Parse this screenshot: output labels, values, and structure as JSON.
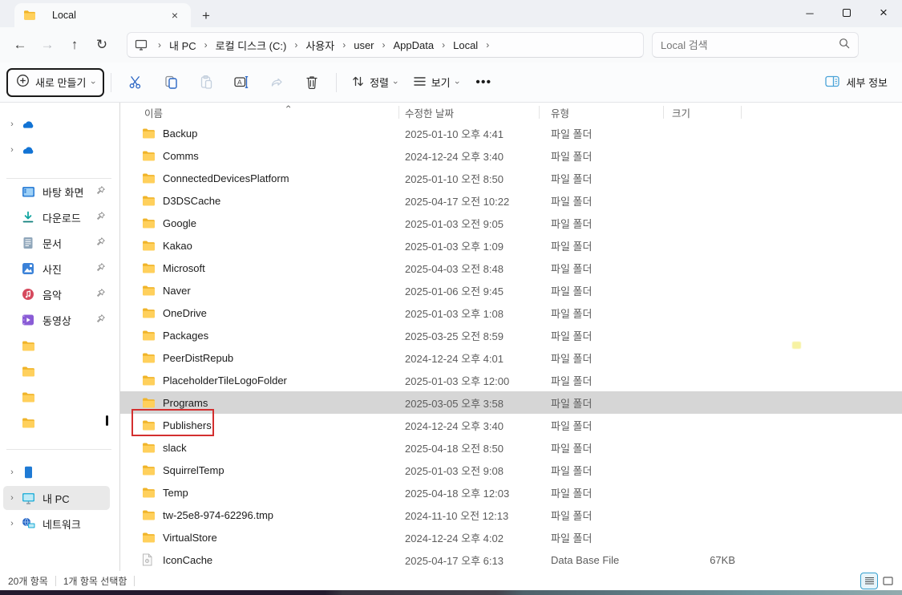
{
  "tabbar": {
    "tab_label": "Local",
    "close_glyph": "×",
    "newtab_glyph": "+",
    "minimize_glyph": "─",
    "close_window_glyph": "×"
  },
  "navbar": {
    "back_glyph": "←",
    "forward_glyph": "→",
    "up_glyph": "↑",
    "refresh_glyph": "↻",
    "breadcrumbs": [
      "내 PC",
      "로컬 디스크 (C:)",
      "사용자",
      "user",
      "AppData",
      "Local"
    ],
    "crumb_sep": "›",
    "search_placeholder": "Local 검색"
  },
  "toolbar": {
    "new_label": "새로 만들기",
    "sort_label": "정렬",
    "view_label": "보기",
    "more_label": "•••",
    "details_label": "세부 정보"
  },
  "sidebar": {
    "pinned": [
      {
        "label": "바탕 화면",
        "icon": "desktop-icon"
      },
      {
        "label": "다운로드",
        "icon": "downloads-icon"
      },
      {
        "label": "문서",
        "icon": "documents-icon"
      },
      {
        "label": "사진",
        "icon": "pictures-icon"
      },
      {
        "label": "음악",
        "icon": "music-icon"
      },
      {
        "label": "동영상",
        "icon": "videos-icon"
      }
    ],
    "tree": [
      {
        "label": "내 PC"
      },
      {
        "label": "네트워크"
      }
    ]
  },
  "list": {
    "columns": [
      "이름",
      "수정한 날짜",
      "유형",
      "크기"
    ],
    "rows": [
      {
        "name": "Backup",
        "date": "2025-01-10 오후 4:41",
        "type": "파일 폴더",
        "size": "",
        "icon": "folder-icon",
        "selected": false
      },
      {
        "name": "Comms",
        "date": "2024-12-24 오후 3:40",
        "type": "파일 폴더",
        "size": "",
        "icon": "folder-icon",
        "selected": false
      },
      {
        "name": "ConnectedDevicesPlatform",
        "date": "2025-01-10 오전 8:50",
        "type": "파일 폴더",
        "size": "",
        "icon": "folder-icon",
        "selected": false
      },
      {
        "name": "D3DSCache",
        "date": "2025-04-17 오전 10:22",
        "type": "파일 폴더",
        "size": "",
        "icon": "folder-icon",
        "selected": false
      },
      {
        "name": "Google",
        "date": "2025-01-03 오전 9:05",
        "type": "파일 폴더",
        "size": "",
        "icon": "folder-icon",
        "selected": false
      },
      {
        "name": "Kakao",
        "date": "2025-01-03 오후 1:09",
        "type": "파일 폴더",
        "size": "",
        "icon": "folder-icon",
        "selected": false
      },
      {
        "name": "Microsoft",
        "date": "2025-04-03 오전 8:48",
        "type": "파일 폴더",
        "size": "",
        "icon": "folder-icon",
        "selected": false
      },
      {
        "name": "Naver",
        "date": "2025-01-06 오전 9:45",
        "type": "파일 폴더",
        "size": "",
        "icon": "folder-icon",
        "selected": false
      },
      {
        "name": "OneDrive",
        "date": "2025-01-03 오후 1:08",
        "type": "파일 폴더",
        "size": "",
        "icon": "folder-icon",
        "selected": false
      },
      {
        "name": "Packages",
        "date": "2025-03-25 오전 8:59",
        "type": "파일 폴더",
        "size": "",
        "icon": "folder-icon",
        "selected": false
      },
      {
        "name": "PeerDistRepub",
        "date": "2024-12-24 오후 4:01",
        "type": "파일 폴더",
        "size": "",
        "icon": "folder-icon",
        "selected": false
      },
      {
        "name": "PlaceholderTileLogoFolder",
        "date": "2025-01-03 오후 12:00",
        "type": "파일 폴더",
        "size": "",
        "icon": "folder-icon",
        "selected": false
      },
      {
        "name": "Programs",
        "date": "2025-03-05 오후 3:58",
        "type": "파일 폴더",
        "size": "",
        "icon": "folder-icon",
        "selected": true
      },
      {
        "name": "Publishers",
        "date": "2024-12-24 오후 3:40",
        "type": "파일 폴더",
        "size": "",
        "icon": "folder-icon",
        "selected": false
      },
      {
        "name": "slack",
        "date": "2025-04-18 오전 8:50",
        "type": "파일 폴더",
        "size": "",
        "icon": "folder-icon",
        "selected": false
      },
      {
        "name": "SquirrelTemp",
        "date": "2025-01-03 오전 9:08",
        "type": "파일 폴더",
        "size": "",
        "icon": "folder-icon",
        "selected": false
      },
      {
        "name": "Temp",
        "date": "2025-04-18 오후 12:03",
        "type": "파일 폴더",
        "size": "",
        "icon": "folder-icon",
        "selected": false
      },
      {
        "name": "tw-25e8-974-62296.tmp",
        "date": "2024-11-10 오전 12:13",
        "type": "파일 폴더",
        "size": "",
        "icon": "folder-icon",
        "selected": false
      },
      {
        "name": "VirtualStore",
        "date": "2024-12-24 오후 4:02",
        "type": "파일 폴더",
        "size": "",
        "icon": "folder-icon",
        "selected": false
      },
      {
        "name": "IconCache",
        "date": "2025-04-17 오후 6:13",
        "type": "Data Base File",
        "size": "67KB",
        "icon": "file-icon",
        "selected": false
      }
    ]
  },
  "statusbar": {
    "items_count": "20개 항목",
    "selected_count": "1개 항목 선택함"
  },
  "colors": {
    "accent_red_annotation": "#d32f2f",
    "selection_gray": "#d6d6d6",
    "folder_yellow": "#ffca45"
  }
}
